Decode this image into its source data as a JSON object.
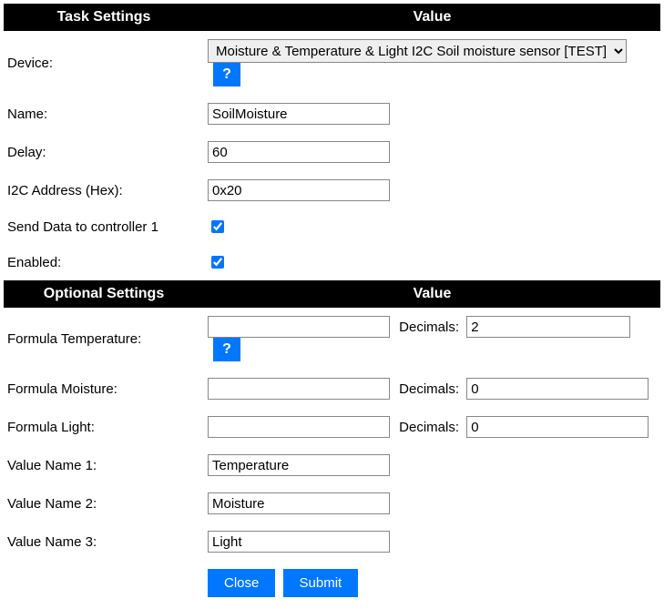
{
  "task_settings": {
    "header_left": "Task Settings",
    "header_right": "Value",
    "device_label": "Device:",
    "device_value": "Moisture & Temperature & Light I2C Soil moisture sensor [TEST]",
    "help_label": "?",
    "name_label": "Name:",
    "name_value": "SoilMoisture",
    "delay_label": "Delay:",
    "delay_value": "60",
    "i2c_label": "I2C Address (Hex):",
    "i2c_value": "0x20",
    "senddata_label": "Send Data to controller 1",
    "senddata_checked": true,
    "enabled_label": "Enabled:",
    "enabled_checked": true
  },
  "optional_settings": {
    "header_left": "Optional Settings",
    "header_right": "Value",
    "decimals_label": "Decimals:",
    "formula_temp_label": "Formula Temperature:",
    "formula_temp_value": "",
    "formula_temp_dec": "2",
    "formula_moist_label": "Formula Moisture:",
    "formula_moist_value": "",
    "formula_moist_dec": "0",
    "formula_light_label": "Formula Light:",
    "formula_light_value": "",
    "formula_light_dec": "0",
    "vn1_label": "Value Name 1:",
    "vn1_value": "Temperature",
    "vn2_label": "Value Name 2:",
    "vn2_value": "Moisture",
    "vn3_label": "Value Name 3:",
    "vn3_value": "Light"
  },
  "buttons": {
    "close": "Close",
    "submit": "Submit"
  }
}
